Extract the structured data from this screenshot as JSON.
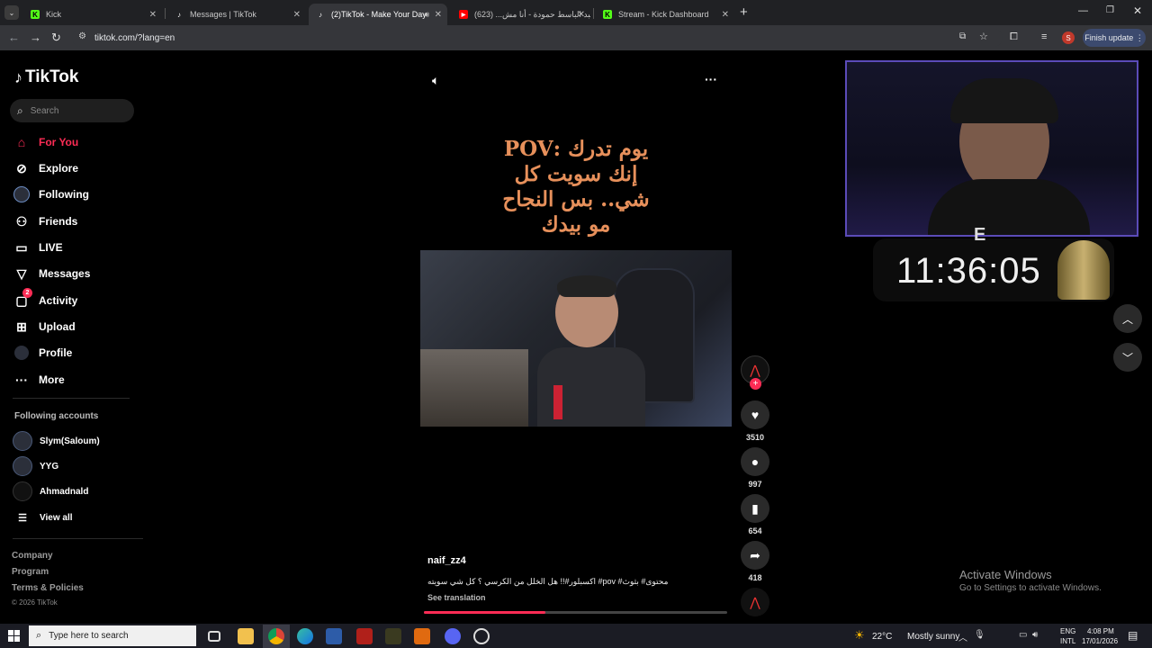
{
  "browser": {
    "tabs": [
      {
        "title": "Kick",
        "active": false
      },
      {
        "title": "Messages | TikTok",
        "active": false
      },
      {
        "title": "(2)TikTok - Make Your Day",
        "active": true
      },
      {
        "title": "عبد الباسط حمودة - أنا مش... (623)",
        "active": false
      },
      {
        "title": "Stream - Kick Dashboard",
        "active": false
      }
    ],
    "url": "tiktok.com/?lang=en",
    "finish_update": "Finish update",
    "profile_initial": "S"
  },
  "sidebar": {
    "logo": "TikTok",
    "search_placeholder": "Search",
    "nav": [
      {
        "label": "For You",
        "icon": "home-icon"
      },
      {
        "label": "Explore",
        "icon": "compass-icon"
      },
      {
        "label": "Following",
        "icon": "following-icon"
      },
      {
        "label": "Friends",
        "icon": "friends-icon"
      },
      {
        "label": "LIVE",
        "icon": "live-icon"
      },
      {
        "label": "Messages",
        "icon": "send-icon"
      },
      {
        "label": "Activity",
        "icon": "activity-icon",
        "badge": "2"
      },
      {
        "label": "Upload",
        "icon": "upload-icon"
      },
      {
        "label": "Profile",
        "icon": "profile-icon"
      },
      {
        "label": "More",
        "icon": "more-icon"
      }
    ],
    "following_header": "Following accounts",
    "accounts": [
      "Slym(Saloum)",
      "YYG",
      "Ahmadnald"
    ],
    "view_all": "View all",
    "footer": [
      "Company",
      "Program",
      "Terms & Policies"
    ],
    "copyright": "© 2026 TikTok"
  },
  "video": {
    "caption_lines": [
      "يوم تدرك :POV",
      "إنك سويت كل",
      "شي.. بس النجاح",
      "مو بيدك"
    ],
    "username": "naif_zz4",
    "description": "محتوى# بثوث# pov# اكسبلور#!! هل الخلل من الكرسي ؟ كل شي سويته",
    "see_translation": "See translation",
    "progress": 0.4,
    "likes": "3510",
    "comments": "997",
    "saves": "654",
    "shares": "418"
  },
  "overlay": {
    "timer": "11:36:05"
  },
  "windows_watermark": {
    "title": "Activate Windows",
    "subtitle": "Go to Settings to activate Windows."
  },
  "taskbar": {
    "search_placeholder": "Type here to search",
    "weather_temp": "22°C",
    "weather_text": "Mostly sunny",
    "lang_1": "ENG",
    "lang_2": "INTL",
    "time": "4:08 PM",
    "date": "17/01/2026"
  },
  "colors": {
    "accent": "#fe2c55",
    "caption": "#e7905b",
    "bg": "#000000"
  }
}
